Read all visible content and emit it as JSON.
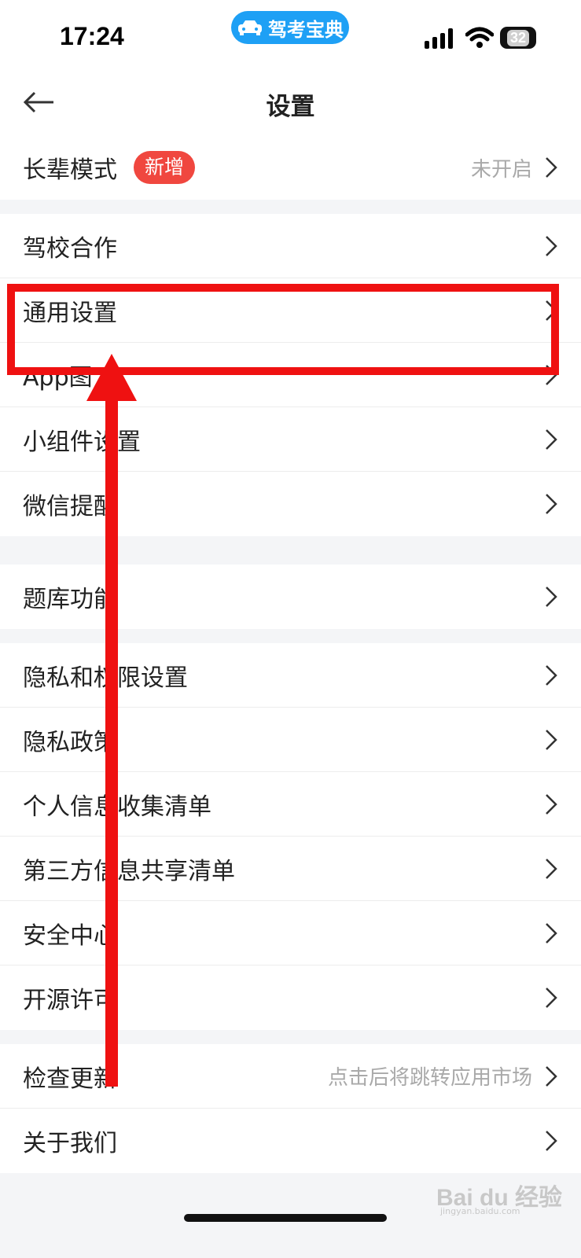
{
  "status_bar": {
    "time": "17:24",
    "app_pill": "驾考宝典",
    "battery": "32"
  },
  "nav": {
    "title": "设置"
  },
  "groups": [
    [
      {
        "label": "长辈模式",
        "badge": "新增",
        "value": "未开启"
      }
    ],
    [
      {
        "label": "驾校合作"
      },
      {
        "label": "通用设置"
      },
      {
        "label": "App图"
      },
      {
        "label": "小组件设置"
      },
      {
        "label": "微信提醒"
      }
    ],
    [
      {
        "label": "题库功能"
      }
    ],
    [
      {
        "label": "隐私和权限设置"
      },
      {
        "label": "隐私政策"
      },
      {
        "label": "个人信息收集清单"
      },
      {
        "label": "第三方信息共享清单"
      },
      {
        "label": "安全中心"
      },
      {
        "label": "开源许可"
      }
    ],
    [
      {
        "label": "检查更新",
        "value": "点击后将跳转应用市场"
      },
      {
        "label": "关于我们"
      }
    ]
  ],
  "watermark": {
    "main": "Bai du 经验",
    "sub": "jingyan.baidu.com"
  },
  "colors": {
    "badge": "#f0473f",
    "annotation": "#ef1111",
    "app_pill": "#1ea0f5"
  }
}
